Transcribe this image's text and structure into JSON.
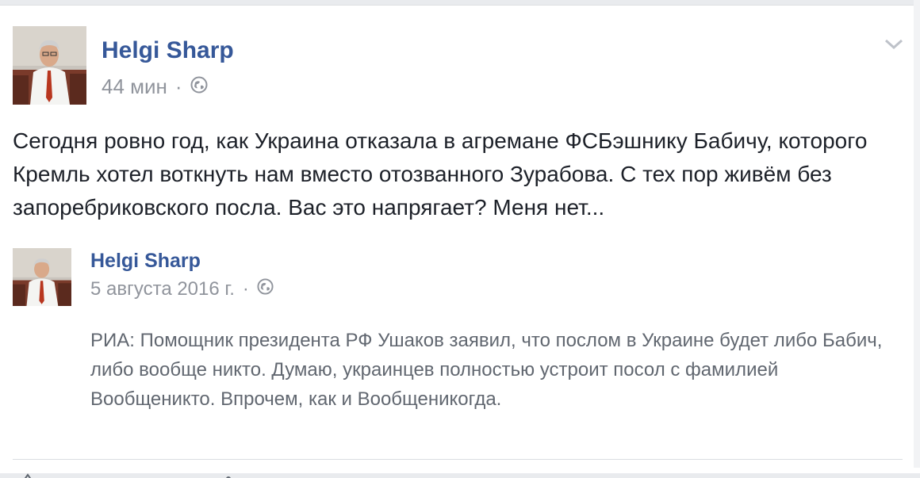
{
  "post": {
    "author": "Helgi Sharp",
    "time": "44 мин",
    "separator": "·",
    "audience_icon": "globe-icon",
    "options_icon": "chevron-down-icon",
    "text": "Сегодня ровно год, как Украина отказала в агремане ФСБэшнику Бабичу, которого Кремль хотел воткнуть нам вместо отозванного Зурабова. С тех пор живём без запоребриковского посла. Вас это напрягает? Меня нет..."
  },
  "shared_post": {
    "author": "Helgi Sharp",
    "date": "5 августа 2016 г.",
    "separator": "·",
    "audience_icon": "globe-icon",
    "text": "РИА: Помощник президента РФ Ушаков заявил, что послом в Украине будет либо Бабич, либо вообще никто. Думаю, украинцев полностью устроит посол с фамилией Вообщеникто. Впрочем, как и Вообщеникогда."
  },
  "colors": {
    "author_link": "#365899",
    "meta_text": "#90949c",
    "body_text": "#1d2129",
    "shared_text": "#616770",
    "background": "#e9ebee"
  }
}
